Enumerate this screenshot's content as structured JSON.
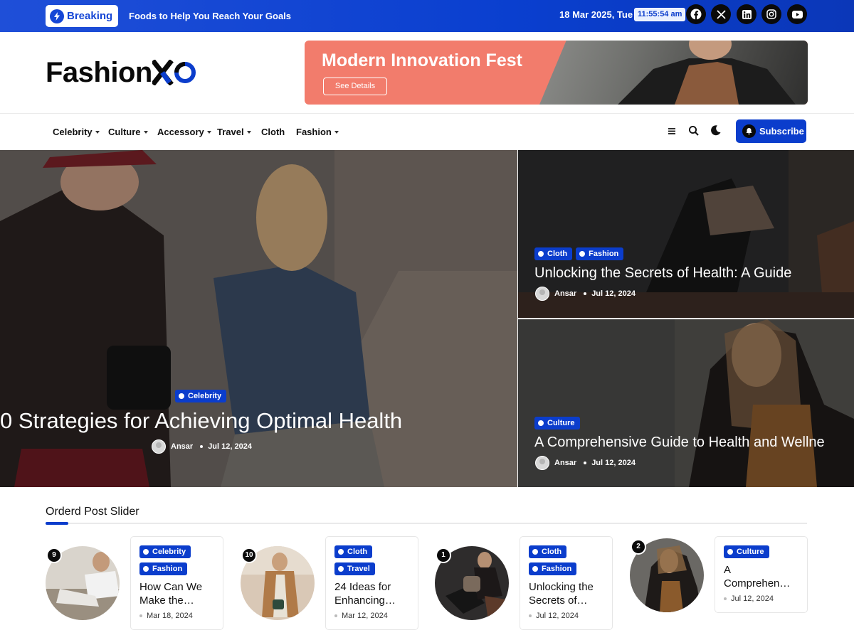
{
  "topbar": {
    "breaking_label": "Breaking",
    "ticker": "Foods to Help You Reach Your Goals",
    "date": "18 Mar 2025, Tue",
    "time": "11:55:54 am",
    "social_icons": [
      "facebook-icon",
      "x-icon",
      "linkedin-icon",
      "instagram-icon",
      "youtube-icon"
    ]
  },
  "header": {
    "logo_text": "Fashion",
    "banner_title": "Modern Innovation Fest",
    "banner_button": "See Details"
  },
  "nav": {
    "items": [
      {
        "label": "Celebrity",
        "has_dropdown": true
      },
      {
        "label": "Culture",
        "has_dropdown": true
      },
      {
        "label": "Accessory",
        "has_dropdown": true
      },
      {
        "label": "Travel",
        "has_dropdown": true
      },
      {
        "label": "Cloth",
        "has_dropdown": false
      },
      {
        "label": "Fashion",
        "has_dropdown": true
      }
    ],
    "subscribe_label": "Subscribe"
  },
  "hero": {
    "main": {
      "tags": [
        "Celebrity"
      ],
      "title": "0 Strategies for Achieving Optimal Health",
      "author": "Ansar",
      "date": "Jul 12, 2024"
    },
    "side": [
      {
        "tags": [
          "Cloth",
          "Fashion"
        ],
        "title": "Unlocking the Secrets of Health: A Guide",
        "author": "Ansar",
        "date": "Jul 12, 2024"
      },
      {
        "tags": [
          "Culture"
        ],
        "title": "A Comprehensive Guide to Health and Wellne",
        "author": "Ansar",
        "date": "Jul 12, 2024"
      }
    ]
  },
  "slider": {
    "title": "Orderd Post Slider",
    "posts": [
      {
        "number": "9",
        "tags": [
          "Celebrity",
          "Fashion"
        ],
        "title_line1": "How Can We",
        "title_line2": "Make the…",
        "date": "Mar 18, 2024"
      },
      {
        "number": "10",
        "tags": [
          "Cloth",
          "Travel"
        ],
        "title_line1": "24 Ideas for",
        "title_line2": "Enhancing…",
        "date": "Mar 12, 2024"
      },
      {
        "number": "1",
        "tags": [
          "Cloth",
          "Fashion"
        ],
        "title_line1": "Unlocking the",
        "title_line2": "Secrets of…",
        "date": "Jul 12, 2024"
      },
      {
        "number": "2",
        "tags": [
          "Culture"
        ],
        "title_line1": "A",
        "title_line2": "Comprehen…",
        "date": "Jul 12, 2024"
      }
    ]
  },
  "colors": {
    "accent": "#0b3dcc",
    "banner": "#f27c6c",
    "topbar": "#1546d6"
  }
}
